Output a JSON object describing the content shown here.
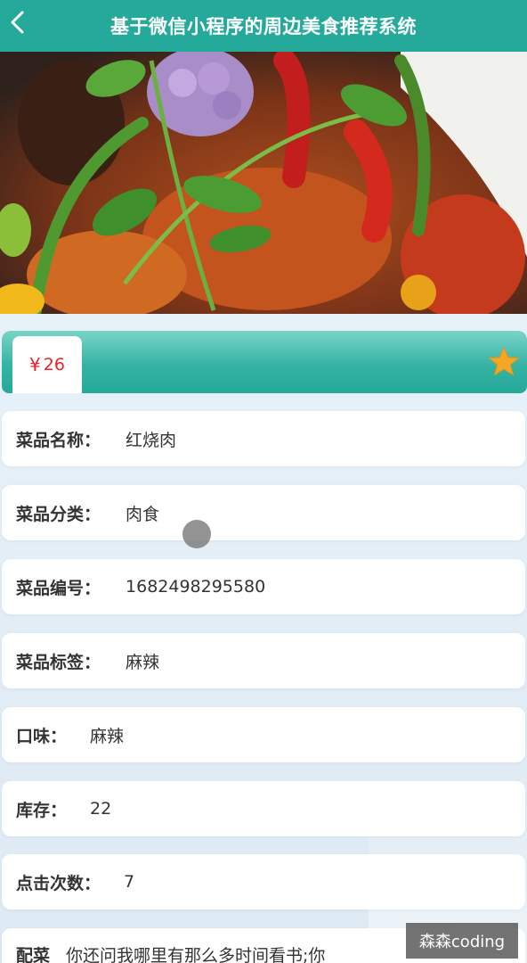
{
  "nav": {
    "title": "基于微信小程序的周边美食推荐系统",
    "back_icon": "chevron-left-icon"
  },
  "hero": {
    "image": "dish-photo"
  },
  "price": {
    "currency": "¥",
    "value": "26",
    "favorite_icon": "star-icon"
  },
  "details": [
    {
      "label": "菜品名称：",
      "value": "红烧肉"
    },
    {
      "label": "菜品分类：",
      "value": "肉食"
    },
    {
      "label": "菜品编号：",
      "value": "1682498295580"
    },
    {
      "label": "菜品标签：",
      "value": "麻辣"
    },
    {
      "label": "口味：",
      "value": "麻辣"
    },
    {
      "label": "库存：",
      "value": "22"
    },
    {
      "label": "点击次数：",
      "value": "7"
    },
    {
      "label": "配菜",
      "value": "你还问我哪里有那么多时间看书;你"
    }
  ],
  "watermark": "森森coding",
  "colors": {
    "nav": "#25a99a",
    "price_text": "#e8232b",
    "star": "#f5a623"
  }
}
